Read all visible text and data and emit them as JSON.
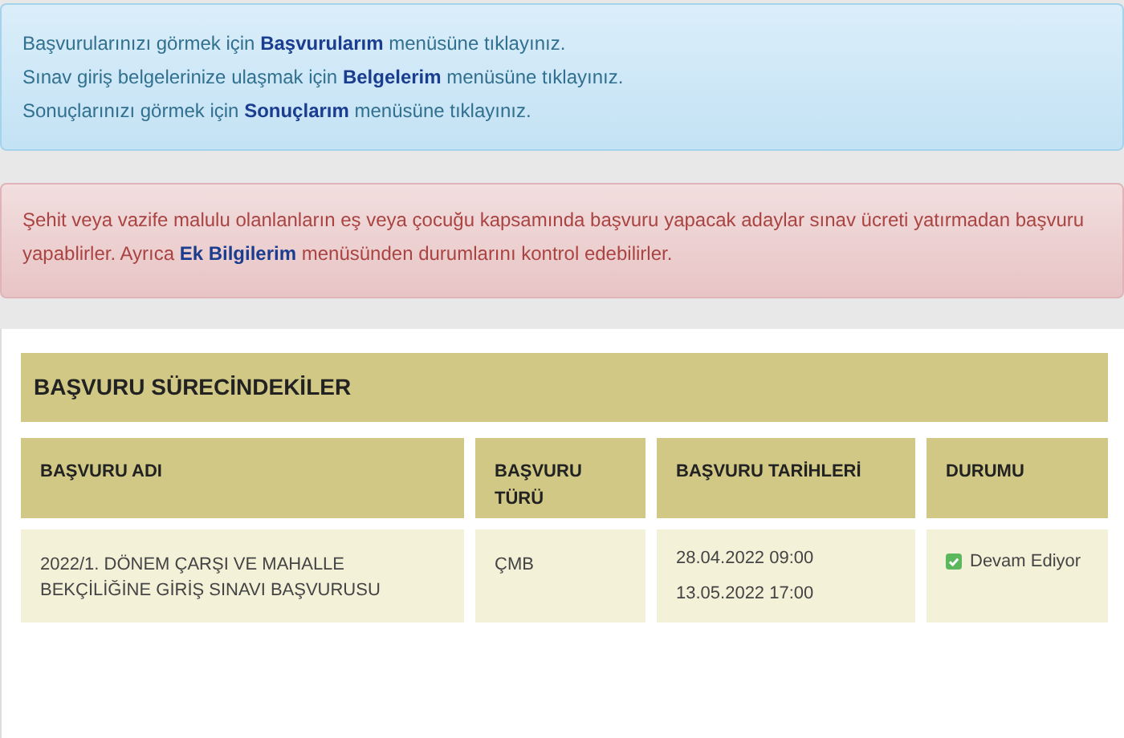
{
  "info_alert": {
    "lines": [
      "Başvurularınızı görmek için **Başvurularım** menüsüne tıklayınız.",
      "Sınav giriş belgelerinize ulaşmak için **Belgelerim** menüsüne tıklayınız.",
      "Sonuçlarınızı görmek için **Sonuçlarım** menüsüne tıklayınız."
    ]
  },
  "warning_alert": {
    "text": "Şehit veya vazife malulu olanlanların eş veya çocuğu kapsamında başvuru yapacak adaylar sınav ücreti yatırmadan başvuru yapablirler. Ayrıca **Ek Bilgilerim** menüsünden durumlarını kontrol edebilirler."
  },
  "panel": {
    "title": "BAŞVURU SÜRECİNDEKİLER",
    "table": {
      "columns": [
        "BAŞVURU ADI",
        "BAŞVURU TÜRÜ",
        "BAŞVURU TARİHLERİ",
        "DURUMU"
      ],
      "rows": [
        {
          "name": "2022/1. DÖNEM ÇARŞI VE MAHALLE BEKÇİLİĞİNE GİRİŞ SINAVI BAŞVURUSU",
          "type": "ÇMB",
          "dates": [
            "28.04.2022 09:00",
            "13.05.2022 17:00"
          ],
          "status": {
            "text": "Devam Ediyor",
            "kind": "ongoing"
          }
        }
      ]
    }
  }
}
